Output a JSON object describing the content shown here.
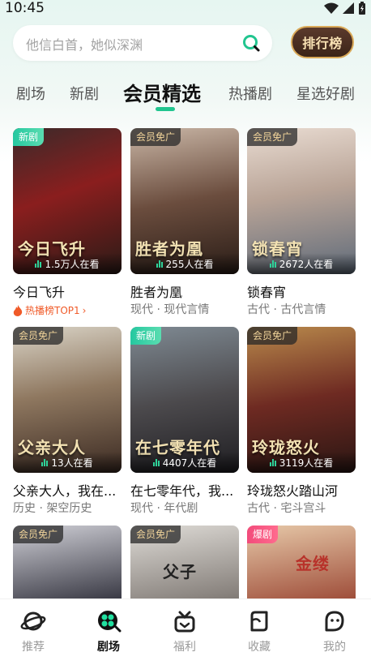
{
  "status_bar": {
    "time": "10:45"
  },
  "search": {
    "placeholder": "他信白首，她似深渊"
  },
  "rank_button": {
    "label": "排行榜"
  },
  "tabs": [
    {
      "label": "剧场",
      "active": false
    },
    {
      "label": "新剧",
      "active": false
    },
    {
      "label": "会员精选",
      "active": true
    },
    {
      "label": "热播剧",
      "active": false
    },
    {
      "label": "星选好剧",
      "active": false
    }
  ],
  "dramas": [
    {
      "badge": "新剧",
      "badge_type": "new",
      "viewers": "1.5万人在看",
      "title": "今日飞升",
      "subtitle": "热播榜TOP1",
      "subtitle_type": "rank",
      "poster_text": "今日飞升"
    },
    {
      "badge": "会员免广",
      "badge_type": "vip",
      "viewers": "255人在看",
      "title": "胜者为凰",
      "subtitle": "现代 · 现代言情",
      "subtitle_type": "tags",
      "poster_text": "胜者为凰"
    },
    {
      "badge": "会员免广",
      "badge_type": "vip",
      "viewers": "2672人在看",
      "title": "锁春宵",
      "subtitle": "古代 · 古代言情",
      "subtitle_type": "tags",
      "poster_text": "锁春宵"
    },
    {
      "badge": "会员免广",
      "badge_type": "vip",
      "viewers": "13人在看",
      "title": "父亲大人，我在...",
      "subtitle": "历史 · 架空历史",
      "subtitle_type": "tags",
      "poster_text": "父亲大人"
    },
    {
      "badge": "新剧",
      "badge_type": "new",
      "viewers": "4407人在看",
      "title": "在七零年代，我...",
      "subtitle": "现代 · 年代剧",
      "subtitle_type": "tags",
      "poster_text": "在七零年代"
    },
    {
      "badge": "会员免广",
      "badge_type": "vip",
      "viewers": "3119人在看",
      "title": "玲珑怒火踏山河",
      "subtitle": "古代 · 宅斗宫斗",
      "subtitle_type": "tags",
      "poster_text": "玲珑怒火"
    },
    {
      "badge": "会员免广",
      "badge_type": "vip",
      "viewers": "",
      "title": "",
      "subtitle": "",
      "subtitle_type": "tags",
      "poster_text": ""
    },
    {
      "badge": "会员免广",
      "badge_type": "vip",
      "viewers": "",
      "title": "",
      "subtitle": "",
      "subtitle_type": "tags",
      "poster_text": "父子"
    },
    {
      "badge": "爆剧",
      "badge_type": "hot",
      "viewers": "",
      "title": "",
      "subtitle": "",
      "subtitle_type": "tags",
      "poster_text": "金缕"
    }
  ],
  "bottom_nav": [
    {
      "label": "推荐",
      "icon": "planet-icon",
      "active": false
    },
    {
      "label": "剧场",
      "icon": "theater-icon",
      "active": true
    },
    {
      "label": "福利",
      "icon": "gift-icon",
      "active": false
    },
    {
      "label": "收藏",
      "icon": "bookmark-icon",
      "active": false
    },
    {
      "label": "我的",
      "icon": "profile-icon",
      "active": false
    }
  ],
  "colors": {
    "accent": "#21c58f",
    "rank_text": "#f05a28"
  }
}
